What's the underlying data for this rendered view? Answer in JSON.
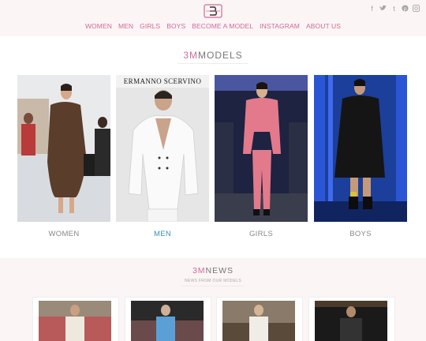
{
  "header": {
    "nav": [
      "WOMEN",
      "MEN",
      "GIRLS",
      "BOYS",
      "BECOME A MODEL",
      "INSTAGRAM",
      "ABOUT US"
    ],
    "social_icons": [
      "facebook-icon",
      "twitter-icon",
      "tumblr-icon",
      "pinterest-icon",
      "instagram-icon"
    ]
  },
  "models": {
    "title_accent": "3M",
    "title_rest": "MODELS",
    "cards": [
      {
        "label": "WOMEN",
        "active": false
      },
      {
        "label": "MEN",
        "active": true,
        "overlay": "ERMANNO SCERVINO"
      },
      {
        "label": "GIRLS",
        "active": false
      },
      {
        "label": "BOYS",
        "active": false
      }
    ]
  },
  "news": {
    "title_accent": "3M",
    "title_rest": "NEWS",
    "subtitle": "NEWS FROM OUR MODELS"
  },
  "colors": {
    "accent": "#d16a9a",
    "active": "#3a8fb7",
    "header_bg": "#fbf5f5"
  }
}
